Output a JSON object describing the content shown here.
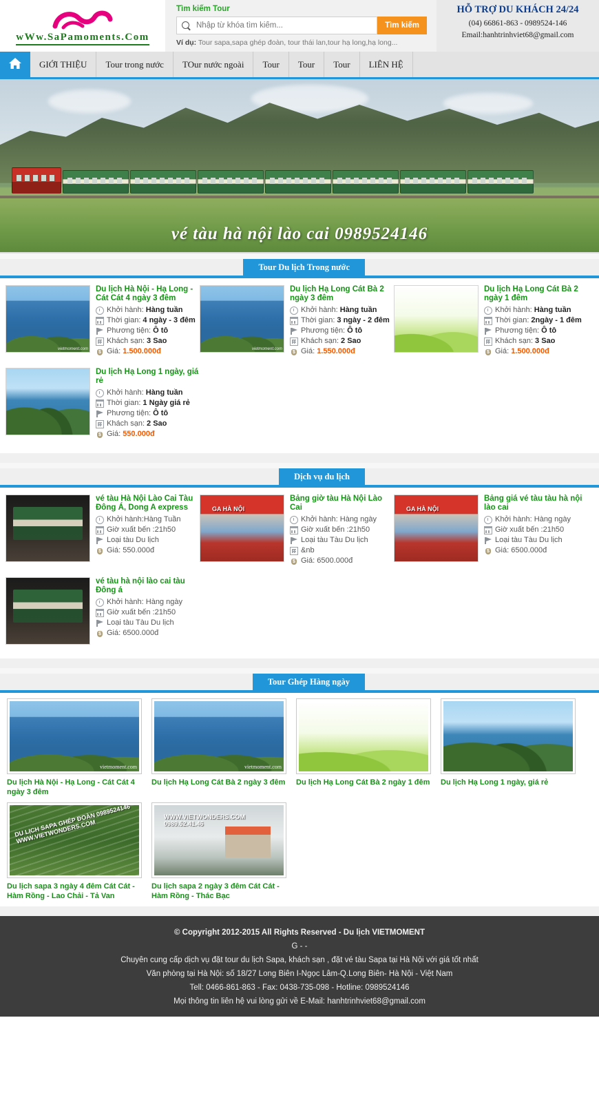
{
  "header": {
    "logo_text": "wWw.SaPamoments.Com",
    "search": {
      "title": "Tìm kiếm Tour",
      "placeholder": "Nhập từ khóa tìm kiếm...",
      "value": "",
      "button": "Tìm kiếm",
      "example_label": "Ví dụ:",
      "example_text": "Tour sapa,sapa ghép đoàn, tour thái lan,tour hạ long,hạ long..."
    },
    "support": {
      "title": "HỖ TRỢ DU KHÁCH 24/24",
      "phone": "(04) 66861-863 - 0989524-146",
      "email": "Email:hanhtrinhviet68@gmail.com"
    }
  },
  "nav": {
    "home_icon": "home-icon",
    "items": [
      {
        "label": "GIỚI THIỆU"
      },
      {
        "label": "Tour trong nước"
      },
      {
        "label": "TOur nước ngoài"
      },
      {
        "label": "Tour"
      },
      {
        "label": "Tour"
      },
      {
        "label": "Tour"
      },
      {
        "label": "LIÊN HỆ"
      }
    ]
  },
  "banner": {
    "overlay_text": "vé tàu hà nội lào cai 0989524146"
  },
  "sections": [
    {
      "title": "Tour Du lịch Trong nước",
      "cards": [
        {
          "title": "Du lịch Hà Nội - Hạ Long - Cát Cát 4 ngày 3 đêm",
          "photo": "ph-halong",
          "watermark": "vietmoment.com",
          "rows": [
            {
              "icon": "clock-icon",
              "label": "Khởi hành:",
              "value": "Hàng tuần",
              "bold": true
            },
            {
              "icon": "calendar-icon",
              "label": "Thời gian:",
              "value": "4 ngày - 3 đêm",
              "bold": true
            },
            {
              "icon": "flag-icon",
              "label": "Phương tiện:",
              "value": "Ô tô",
              "bold": true
            },
            {
              "icon": "hotel-icon",
              "label": "Khách sạn:",
              "value": "3 Sao",
              "bold": true
            },
            {
              "icon": "money-icon",
              "label": "Giá:",
              "value": "1.500.000đ",
              "price": true
            }
          ]
        },
        {
          "title": "Du lịch Hạ Long Cát Bà 2 ngày 3 đêm",
          "photo": "ph-halong",
          "watermark": "vietmoment.com",
          "rows": [
            {
              "icon": "clock-icon",
              "label": "Khởi hành:",
              "value": "Hàng tuần",
              "bold": true
            },
            {
              "icon": "calendar-icon",
              "label": "Thời gian:",
              "value": "3 ngày - 2 đêm",
              "bold": true
            },
            {
              "icon": "flag-icon",
              "label": "Phương tiện:",
              "value": "Ô tô",
              "bold": true
            },
            {
              "icon": "hotel-icon",
              "label": "Khách sạn:",
              "value": "2 Sao",
              "bold": true
            },
            {
              "icon": "money-icon",
              "label": "Giá:",
              "value": "1.550.000đ",
              "price": true
            }
          ]
        },
        {
          "title": "Du lịch Hạ Long Cát Bà 2 ngày 1 đêm",
          "photo": "ph-spring",
          "watermark": "",
          "rows": [
            {
              "icon": "clock-icon",
              "label": "Khởi hành:",
              "value": "Hàng tuần",
              "bold": true
            },
            {
              "icon": "calendar-icon",
              "label": "Thời gian:",
              "value": "2ngày - 1 đêm",
              "bold": true
            },
            {
              "icon": "flag-icon",
              "label": "Phương tiện:",
              "value": "Ô tô",
              "bold": true
            },
            {
              "icon": "hotel-icon",
              "label": "Khách sạn:",
              "value": "3 Sao",
              "bold": true
            },
            {
              "icon": "money-icon",
              "label": "Giá:",
              "value": "1.500.000đ",
              "price": true
            }
          ]
        },
        {
          "title": "Du lịch Hạ Long 1 ngày, giá rẻ",
          "photo": "ph-karst",
          "watermark": "",
          "rows": [
            {
              "icon": "clock-icon",
              "label": "Khởi hành:",
              "value": "Hàng tuần",
              "bold": true
            },
            {
              "icon": "calendar-icon",
              "label": "Thời gian:",
              "value": "1 Ngày giá rẻ",
              "bold": true
            },
            {
              "icon": "flag-icon",
              "label": "Phương tiện:",
              "value": "Ô tô",
              "bold": true
            },
            {
              "icon": "hotel-icon",
              "label": "Khách sạn:",
              "value": "2 Sao",
              "bold": true
            },
            {
              "icon": "money-icon",
              "label": "Giá:",
              "value": "550.000đ",
              "price": true
            }
          ]
        }
      ]
    },
    {
      "title": "Dịch vụ du lịch",
      "cards": [
        {
          "title": "vé tàu Hà Nội Lào Cai Tàu Đông Á, Dong A express",
          "photo": "ph-train",
          "watermark": "",
          "rows": [
            {
              "icon": "clock-icon",
              "label": "Khởi hành:Hàng Tuần",
              "value": "",
              "bold": false
            },
            {
              "icon": "calendar-icon",
              "label": "Giờ xuất bến :21h50",
              "value": "",
              "bold": false
            },
            {
              "icon": "flag-icon",
              "label": "Loại tàu Du lịch",
              "value": "",
              "bold": false
            },
            {
              "icon": "money-icon",
              "label": "Giá: 550.000đ",
              "value": "",
              "bold": false
            }
          ]
        },
        {
          "title": "Bảng giờ tàu Hà Nội Lào Cai",
          "photo": "ph-station",
          "watermark": "",
          "rows": [
            {
              "icon": "clock-icon",
              "label": "Khởi hành: Hàng ngày",
              "value": "",
              "bold": false
            },
            {
              "icon": "calendar-icon",
              "label": "Giờ xuất bến :21h50",
              "value": "",
              "bold": false
            },
            {
              "icon": "flag-icon",
              "label": "Loại tàu Tàu Du lịch",
              "value": "",
              "bold": false
            },
            {
              "icon": "hotel-icon",
              "label": "&nb",
              "value": "",
              "bold": false
            },
            {
              "icon": "money-icon",
              "label": "Giá: 6500.000đ",
              "value": "",
              "bold": false
            }
          ]
        },
        {
          "title": "Bảng giá vé tàu tàu hà nội lào cai",
          "photo": "ph-station",
          "watermark": "",
          "rows": [
            {
              "icon": "clock-icon",
              "label": "Khởi hành: Hàng ngày",
              "value": "",
              "bold": false
            },
            {
              "icon": "calendar-icon",
              "label": "Giờ xuất bến :21h50",
              "value": "",
              "bold": false
            },
            {
              "icon": "flag-icon",
              "label": "Loại tàu Tàu Du lịch",
              "value": "",
              "bold": false
            },
            {
              "icon": "money-icon",
              "label": "Giá: 6500.000đ",
              "value": "",
              "bold": false
            }
          ]
        },
        {
          "title": "vé tàu hà nội lào cai tàu Đông á",
          "photo": "ph-train",
          "watermark": "",
          "rows": [
            {
              "icon": "clock-icon",
              "label": "Khởi hành: Hàng ngày",
              "value": "",
              "bold": false
            },
            {
              "icon": "calendar-icon",
              "label": "Giờ xuất bến :21h50",
              "value": "",
              "bold": false
            },
            {
              "icon": "flag-icon",
              "label": "Loại tàu Tàu Du lịch",
              "value": "",
              "bold": false
            },
            {
              "icon": "money-icon",
              "label": "Giá: 6500.000đ",
              "value": "",
              "bold": false
            }
          ]
        }
      ]
    }
  ],
  "gallery": {
    "title": "Tour Ghép Hàng ngày",
    "items": [
      {
        "caption": "Du lịch Hà Nội - Hạ Long - Cát Cát 4 ngày 3 đêm",
        "photo": "ph-halong",
        "watermark": "vietmoment.com",
        "overlay": ""
      },
      {
        "caption": "Du lịch Hạ Long Cát Bà 2 ngày 3 đêm",
        "photo": "ph-halong",
        "watermark": "vietmoment.com",
        "overlay": ""
      },
      {
        "caption": "Du lịch Hạ Long Cát Bà 2 ngày 1 đêm",
        "photo": "ph-spring",
        "watermark": "",
        "overlay": ""
      },
      {
        "caption": "Du lịch Hạ Long 1 ngày, giá rẻ",
        "photo": "ph-karst",
        "watermark": "",
        "overlay": ""
      },
      {
        "caption": "Du lịch sapa 3 ngày 4 đêm Cát Cát - Hàm Rồng - Lao Chải - Tả Van",
        "photo": "ph-terrace",
        "watermark": "",
        "overlay": "DU LỊCH SAPA GHÉP ĐOÀN 0989524146 WWW.VIETWONDERS.COM"
      },
      {
        "caption": "Du lịch sapa 2 ngày 3 đêm Cát Cát - Hàm Rồng - Thác Bạc",
        "photo": "ph-cloud",
        "watermark": "",
        "overlay": "WWW.VIETWONDERS.COM 0989.52.41.46"
      }
    ]
  },
  "footer": {
    "lines": [
      "© Copyright 2012-2015 All Rights Reserved - Du lịch VIETMOMENT",
      "G - -",
      "Chuyên cung cấp dịch vụ đặt tour du lịch Sapa, khách sạn , đặt vé tàu Sapa tại Hà Nội với giá tốt nhất",
      "Văn phòng tại Hà Nội: số 18/27 Long Biên I-Ngọc Lâm-Q.Long Biên- Hà Nội - Việt Nam",
      "Tell: 0466-861-863 - Fax: 0438-735-098 - Hotline: 0989524146",
      "Mọi thông tin liên hệ vui lòng gửi về E-Mail: hanhtrinhviet68@gmail.com"
    ]
  }
}
